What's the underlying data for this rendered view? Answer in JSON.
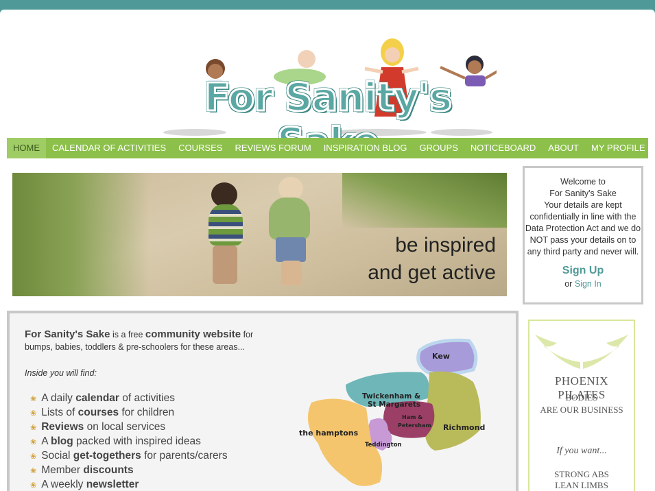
{
  "site": {
    "logo_text": "For Sanity's Sake"
  },
  "nav": {
    "items": [
      "HOME",
      "CALENDAR OF ACTIVITIES",
      "COURSES",
      "REVIEWS FORUM",
      "INSPIRATION BLOG",
      "GROUPS",
      "NOTICEBOARD",
      "ABOUT",
      "MY PROFILE"
    ],
    "active": "HOME"
  },
  "hero": {
    "line1": "be inspired",
    "line2": "and get active"
  },
  "welcome": {
    "line1": "Welcome to",
    "line2": "For Sanity's Sake",
    "body": "Your details are kept confidentially in line with the Data Protection Act and we do NOT pass your details on to any third party and never will.",
    "signup": "Sign Up",
    "or": "or",
    "signin": "Sign In"
  },
  "intro": {
    "name": "For Sanity's Sake",
    "is_a_free": "is a free",
    "community": "community website",
    "for": "for",
    "rest": "bumps, babies, toddlers & pre-schoolers for these areas...",
    "inside": "Inside you will find:"
  },
  "features": [
    {
      "pre": "A daily ",
      "bold": "calendar",
      "post": " of activities"
    },
    {
      "pre": "Lists of ",
      "bold": "courses",
      "post": " for children"
    },
    {
      "pre": "",
      "bold": "Reviews",
      "post": " on local services"
    },
    {
      "pre": "A ",
      "bold": "blog",
      "post": " packed with inspired ideas"
    },
    {
      "pre": "Social ",
      "bold": "get-togethers",
      "post": " for parents/carers"
    },
    {
      "pre": "Member ",
      "bold": "discounts",
      "post": ""
    },
    {
      "pre": "A weekly ",
      "bold": "newsletter",
      "post": ""
    }
  ],
  "map": {
    "kew": "Kew",
    "twickenham": "Twickenham &",
    "st_margarets": "St Margarets",
    "ham": "Ham &",
    "petersham": "Petersham",
    "richmond": "Richmond",
    "hamptons": "the hamptons",
    "teddington": "Teddington"
  },
  "ad": {
    "brand": "PHOENIX PILATES",
    "sub1": "BODIES",
    "sub2": "ARE OUR BUSINESS",
    "want": "If you want...",
    "benefit1": "STRONG ABS",
    "benefit2": "LEAN LIMBS"
  },
  "colors": {
    "teal": "#4f9a98",
    "nav_green": "#8cc04b",
    "bullet": "#d2a13a"
  }
}
